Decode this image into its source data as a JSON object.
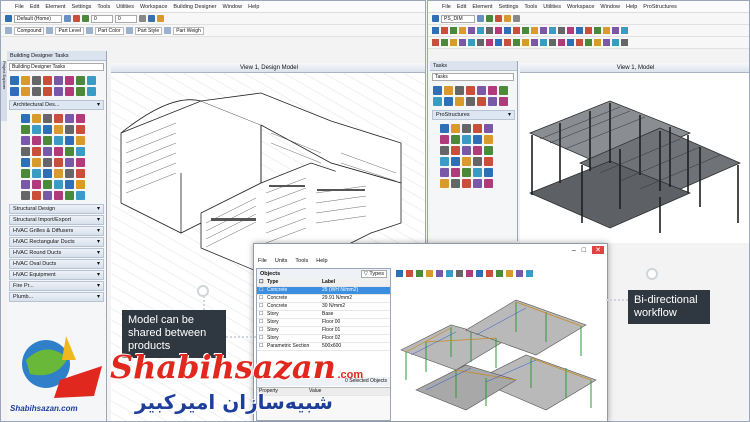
{
  "left_app": {
    "menu": [
      "File",
      "Edit",
      "Element",
      "Settings",
      "Tools",
      "Utilities",
      "Workspace",
      "Building Designer",
      "Window",
      "Help"
    ],
    "model_select": "Default (Home)",
    "attr_labels": [
      "Compound",
      "Part Level",
      "Part Color",
      "Part Style",
      "Part Weigh"
    ],
    "panel_title": "Building Designer Tasks",
    "panel_select": "Building Designer Tasks",
    "section_title": "Architectural Des...",
    "categories": [
      "Structural Design",
      "Structural Import/Export",
      "HVAC Grilles & Diffusers",
      "HVAC Rectangular Ducts",
      "HVAC Round Ducts",
      "HVAC Oval Ducts",
      "HVAC Equipment",
      "Fire Pr...",
      "Plumb..."
    ],
    "view_title": "View 1, Design Model",
    "sidebar_tab": "Project Explorer"
  },
  "right_app": {
    "menu": [
      "File",
      "Edit",
      "Element",
      "Settings",
      "Tools",
      "Utilities",
      "Workspace",
      "Window",
      "Help",
      "ProStructures"
    ],
    "model_select": "PS_DIM",
    "panel_title": "Tasks",
    "panel_select": "Tasks",
    "section_title": "ProStructures",
    "view_title": "View 1, Model"
  },
  "dialog": {
    "menu": [
      "File",
      "Units",
      "Tools",
      "Help"
    ],
    "objects_title": "Objects",
    "types_label": "Types",
    "columns": [
      "Type",
      "Label"
    ],
    "rows": [
      {
        "type": "Concrete",
        "label": "25 (WH N/mm2)"
      },
      {
        "type": "Concrete",
        "label": "29.91 N/mm2"
      },
      {
        "type": "Concrete",
        "label": "30 N/mm2"
      },
      {
        "type": "Story",
        "label": "Base"
      },
      {
        "type": "Story",
        "label": "Floor 00"
      },
      {
        "type": "Story",
        "label": "Floor 01"
      },
      {
        "type": "Story",
        "label": "Floor 02"
      },
      {
        "type": "Parametric Section",
        "label": "500x600"
      }
    ],
    "selected_status": "0 Selected Objects",
    "prop_columns": [
      "Property",
      "Value"
    ]
  },
  "callouts": {
    "left": "Model can be shared between products",
    "right": "Bi-directional workflow"
  },
  "watermark": {
    "brand": "Shabihsazan",
    "domain": ".com",
    "logo_text": "Shabihsazan.com",
    "persian": "شبیه‌سازان امیرکبیر"
  },
  "colors": {
    "accent": "#2f6fb5",
    "callout_bg": "#2f3840",
    "watermark_red": "#e0281e",
    "watermark_blue": "#1d3f9a"
  }
}
